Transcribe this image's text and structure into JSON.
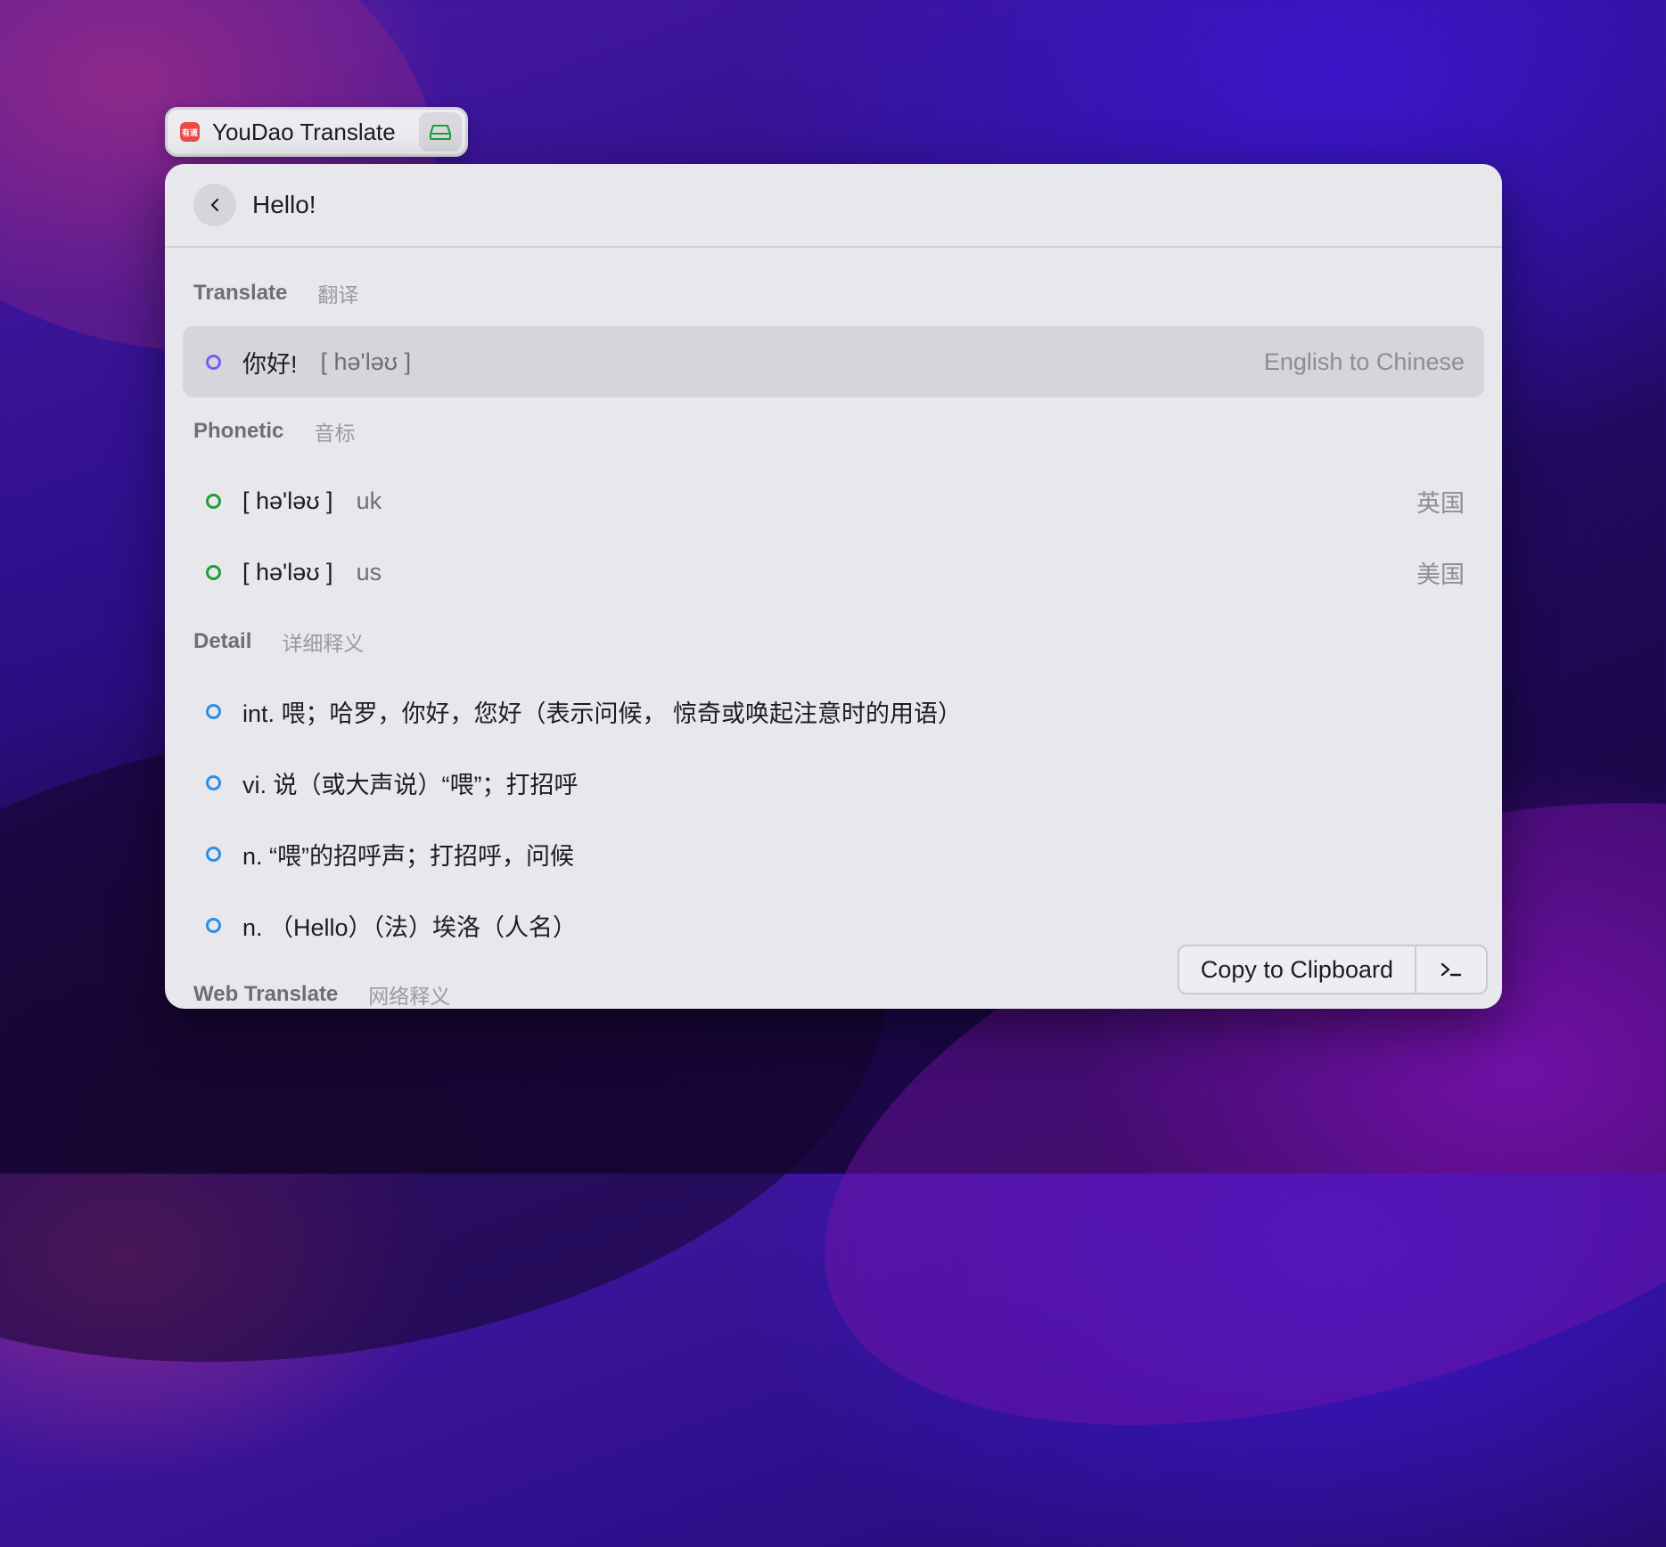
{
  "extension": {
    "title": "YouDao Translate",
    "logo_icon": "youdao-logo-icon",
    "action_icon": "hard-drive-icon",
    "action_color": "#1e9e3a"
  },
  "header": {
    "query": "Hello!",
    "back_icon": "chevron-left-icon"
  },
  "sections": {
    "translate": {
      "title": "Translate",
      "title_zh": "翻译",
      "items": [
        {
          "text": "你好!",
          "phonetic": "[ hə'ləʊ ]",
          "accessory": "English to Chinese",
          "dot_color": "#7c5cf0",
          "selected": true
        }
      ]
    },
    "phonetic": {
      "title": "Phonetic",
      "title_zh": "音标",
      "items": [
        {
          "text": "[ hə'ləʊ ]",
          "sub": "uk",
          "accessory": "英国",
          "dot_color": "#1e9e3a"
        },
        {
          "text": "[ hə'ləʊ ]",
          "sub": "us",
          "accessory": "美国",
          "dot_color": "#1e9e3a"
        }
      ]
    },
    "detail": {
      "title": "Detail",
      "title_zh": "详细释义",
      "items": [
        {
          "text": "int. 喂；哈罗，你好，您好（表示问候， 惊奇或唤起注意时的用语）",
          "dot_color": "#2a8ee6"
        },
        {
          "text": "vi. 说（或大声说）“喂”；打招呼",
          "dot_color": "#2a8ee6"
        },
        {
          "text": "n. “喂”的招呼声；打招呼，问候",
          "dot_color": "#2a8ee6"
        },
        {
          "text": "n. （Hello）（法）埃洛（人名）",
          "dot_color": "#2a8ee6"
        }
      ]
    },
    "web": {
      "title": "Web Translate",
      "title_zh": "网络释义"
    }
  },
  "action_bar": {
    "primary_label": "Copy to Clipboard",
    "shortcut_icon": "terminal-icon"
  }
}
